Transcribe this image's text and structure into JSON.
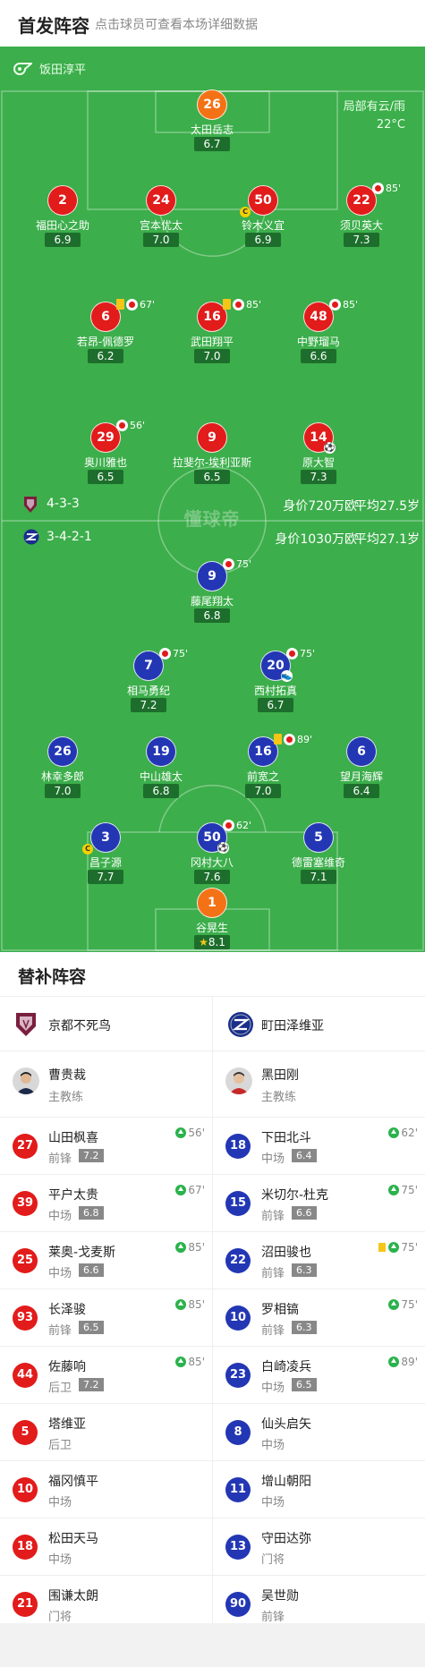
{
  "header": {
    "title": "首发阵容",
    "subtitle": "点击球员可查看本场详细数据"
  },
  "pitch": {
    "referee": "饭田淳平",
    "weather": "局部有云/雨",
    "temperature": "22°C",
    "watermark": "懂球帝",
    "home": {
      "formation": "4-3-3",
      "value": "身价720万欧",
      "age": "平均27.5岁"
    },
    "away": {
      "formation": "3-4-2-1",
      "value": "身价1030万欧",
      "age": "平均27.1岁"
    }
  },
  "home_players": [
    {
      "num": "26",
      "name": "太田岳志",
      "rating": "6.7",
      "color": "orange"
    },
    {
      "num": "2",
      "name": "福田心之助",
      "rating": "6.9",
      "color": "red"
    },
    {
      "num": "24",
      "name": "宫本优太",
      "rating": "7.0",
      "color": "red"
    },
    {
      "num": "50",
      "name": "铃木义宜",
      "rating": "6.9",
      "color": "red",
      "captain": "C"
    },
    {
      "num": "22",
      "name": "须贝英大",
      "rating": "7.3",
      "color": "red",
      "sub_out": "85'"
    },
    {
      "num": "6",
      "name": "若昂-佩德罗",
      "rating": "6.2",
      "color": "red",
      "yellow": true,
      "sub_out": "67'"
    },
    {
      "num": "16",
      "name": "武田翔平",
      "rating": "7.0",
      "color": "red",
      "yellow": true,
      "sub_out": "85'"
    },
    {
      "num": "48",
      "name": "中野瑠马",
      "rating": "6.6",
      "color": "red",
      "sub_out": "85'"
    },
    {
      "num": "29",
      "name": "奥川雅也",
      "rating": "6.5",
      "color": "red",
      "sub_out": "56'"
    },
    {
      "num": "9",
      "name": "拉斐尔-埃利亚斯",
      "rating": "6.5",
      "color": "red"
    },
    {
      "num": "14",
      "name": "原大智",
      "rating": "7.3",
      "color": "red",
      "goal": true
    }
  ],
  "away_players": [
    {
      "num": "9",
      "name": "藤尾翔太",
      "rating": "6.8",
      "color": "blue",
      "sub_out": "75'"
    },
    {
      "num": "7",
      "name": "相马勇纪",
      "rating": "7.2",
      "color": "blue",
      "sub_out": "75'"
    },
    {
      "num": "20",
      "name": "西村拓真",
      "rating": "6.7",
      "color": "blue",
      "sub_out": "75'",
      "assist": true
    },
    {
      "num": "26",
      "name": "林幸多郎",
      "rating": "7.0",
      "color": "blue"
    },
    {
      "num": "19",
      "name": "中山雄太",
      "rating": "6.8",
      "color": "blue"
    },
    {
      "num": "16",
      "name": "前宽之",
      "rating": "7.0",
      "color": "blue",
      "yellow": true,
      "sub_out": "89'"
    },
    {
      "num": "6",
      "name": "望月海辉",
      "rating": "6.4",
      "color": "blue"
    },
    {
      "num": "3",
      "name": "昌子源",
      "rating": "7.7",
      "color": "blue",
      "captain": "C"
    },
    {
      "num": "50",
      "name": "冈村大八",
      "rating": "7.6",
      "color": "blue",
      "sub_out": "62'",
      "goal": true
    },
    {
      "num": "5",
      "name": "德雷塞维奇",
      "rating": "7.1",
      "color": "blue"
    },
    {
      "num": "1",
      "name": "谷晃生",
      "rating": "8.1",
      "color": "orange",
      "mvp": true
    }
  ],
  "subs": {
    "title": "替补阵容",
    "coach_role": "主教练",
    "left": {
      "team": "京都不死鸟",
      "coach": "曹贵裁",
      "players": [
        {
          "num": "27",
          "name": "山田枫喜",
          "pos": "前锋",
          "rating": "7.2",
          "in": "56'"
        },
        {
          "num": "39",
          "name": "平户太贵",
          "pos": "中场",
          "rating": "6.8",
          "in": "67'"
        },
        {
          "num": "25",
          "name": "莱奥-戈麦斯",
          "pos": "中场",
          "rating": "6.6",
          "in": "85'"
        },
        {
          "num": "93",
          "name": "长泽骏",
          "pos": "前锋",
          "rating": "6.5",
          "in": "85'"
        },
        {
          "num": "44",
          "name": "佐藤响",
          "pos": "后卫",
          "rating": "7.2",
          "in": "85'"
        },
        {
          "num": "5",
          "name": "塔维亚",
          "pos": "后卫"
        },
        {
          "num": "10",
          "name": "福冈慎平",
          "pos": "中场"
        },
        {
          "num": "18",
          "name": "松田天马",
          "pos": "中场"
        },
        {
          "num": "21",
          "name": "围谦太朗",
          "pos": "门将"
        }
      ]
    },
    "right": {
      "team": "町田泽维亚",
      "coach": "黑田刚",
      "players": [
        {
          "num": "18",
          "name": "下田北斗",
          "pos": "中场",
          "rating": "6.4",
          "in": "62'"
        },
        {
          "num": "15",
          "name": "米切尔-杜克",
          "pos": "前锋",
          "rating": "6.6",
          "in": "75'"
        },
        {
          "num": "22",
          "name": "沼田骏也",
          "pos": "前锋",
          "rating": "6.3",
          "in": "75'",
          "yellow": true
        },
        {
          "num": "10",
          "name": "罗相镐",
          "pos": "前锋",
          "rating": "6.3",
          "in": "75'"
        },
        {
          "num": "23",
          "name": "白崎凌兵",
          "pos": "中场",
          "rating": "6.5",
          "in": "89'"
        },
        {
          "num": "8",
          "name": "仙头启矢",
          "pos": "中场"
        },
        {
          "num": "11",
          "name": "增山朝阳",
          "pos": "中场"
        },
        {
          "num": "13",
          "name": "守田达弥",
          "pos": "门将"
        },
        {
          "num": "90",
          "name": "吴世勋",
          "pos": "前锋"
        }
      ]
    }
  },
  "colors": {
    "pitch": "#3cae4b",
    "home": "#e21b1b",
    "away": "#2337b5",
    "keeper": "#f47216",
    "sub_in": "#2bb24c"
  }
}
